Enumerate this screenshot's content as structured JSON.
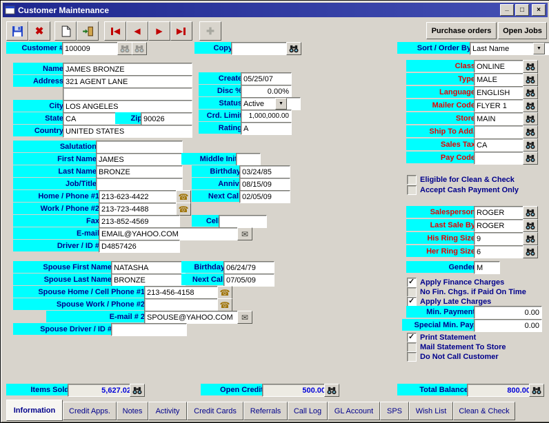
{
  "window": {
    "title": "Customer Maintenance"
  },
  "icons": {
    "minimize": "_",
    "maximize": "□",
    "close": "×",
    "delete": "✖",
    "plus": "✚",
    "prev": "◀",
    "next": "▶",
    "dropdown": "▼",
    "phone": "☎",
    "mail": "✉"
  },
  "toolbar": {
    "purchase_orders": "Purchase orders",
    "open_jobs": "Open Jobs"
  },
  "header": {
    "customer_label": "Customer #",
    "customer_value": "100009",
    "copy_label": "Copy",
    "copy_value": "",
    "sort_label": "Sort / Order By",
    "sort_value": "Last Name"
  },
  "left": {
    "name": {
      "label": "Name",
      "value": "JAMES BRONZE"
    },
    "address": {
      "label": "Address",
      "value": "321 AGENT LANE"
    },
    "address2": {
      "value": ""
    },
    "city": {
      "label": "City",
      "value": "LOS ANGELES"
    },
    "state": {
      "label": "State",
      "value": "CA"
    },
    "zip": {
      "label": "Zip",
      "value": "90026"
    },
    "country": {
      "label": "Country",
      "value": "UNITED STATES"
    },
    "salutation": {
      "label": "Salutation",
      "value": ""
    },
    "first_name": {
      "label": "First Name",
      "value": "JAMES"
    },
    "middle_init": {
      "label": "Middle Init",
      "value": ""
    },
    "last_name": {
      "label": "Last Name",
      "value": "BRONZE"
    },
    "job_title": {
      "label": "Job/Title",
      "value": ""
    },
    "home_phone": {
      "label": "Home / Phone #1",
      "value": "213-623-4422"
    },
    "work_phone": {
      "label": "Work / Phone #2",
      "value": "213-723-4488"
    },
    "fax": {
      "label": "Fax",
      "value": "213-852-4569"
    },
    "cell": {
      "label": "Cell",
      "value": ""
    },
    "email": {
      "label": "E-mail",
      "value": "EMAIL@YAHOO.COM"
    },
    "driver_id": {
      "label": "Driver / ID #",
      "value": "D4857426"
    },
    "spouse_first": {
      "label": "Spouse First Name",
      "value": "NATASHA"
    },
    "spouse_last": {
      "label": "Spouse Last Name",
      "value": "BRONZE"
    },
    "spouse_home": {
      "label": "Spouse Home / Cell Phone #1",
      "value": "213-456-4158"
    },
    "spouse_work": {
      "label": "Spouse Work / Phone #2",
      "value": ""
    },
    "email2": {
      "label": "E-mail # 2",
      "value": "SPOUSE@YAHOO.COM"
    },
    "spouse_driver": {
      "label": "Spouse Driver / ID #",
      "value": ""
    }
  },
  "mid": {
    "create": {
      "label": "Create",
      "value": "05/25/07"
    },
    "disc": {
      "label": "Disc %",
      "value": "0.00%"
    },
    "status": {
      "label": "Status",
      "value": "Active"
    },
    "crd_limit": {
      "label": "Crd. Limit",
      "value": "1,000,000.00"
    },
    "rating": {
      "label": "Rating",
      "value": "A"
    },
    "birthday": {
      "label": "Birthday",
      "value": "03/24/85"
    },
    "anniv": {
      "label": "Anniv.",
      "value": "08/15/09"
    },
    "next_call": {
      "label": "Next Call",
      "value": "02/05/09"
    },
    "spouse_birthday": {
      "label": "Birthday",
      "value": "06/24/79"
    },
    "spouse_next_call": {
      "label": "Next Call",
      "value": "07/05/09"
    }
  },
  "right": {
    "class": {
      "label": "Class",
      "value": "ONLINE"
    },
    "type": {
      "label": "Type",
      "value": "MALE"
    },
    "language": {
      "label": "Language",
      "value": "ENGLISH"
    },
    "mailer_code": {
      "label": "Mailer Code",
      "value": "FLYER 1"
    },
    "store": {
      "label": "Store",
      "value": "MAIN"
    },
    "ship_to": {
      "label": "Ship To Add.",
      "value": ""
    },
    "sales_tax": {
      "label": "Sales Tax",
      "value": "CA"
    },
    "pay_code": {
      "label": "Pay Code",
      "value": ""
    },
    "salesperson": {
      "label": "Salesperson",
      "value": "ROGER"
    },
    "last_sale_by": {
      "label": "Last Sale By",
      "value": "ROGER"
    },
    "his_ring": {
      "label": "His Ring Size",
      "value": "9"
    },
    "her_ring": {
      "label": "Her Ring Size",
      "value": "6"
    },
    "gender": {
      "label": "Gender",
      "value": "M"
    },
    "min_payment": {
      "label": "Min. Payment",
      "value": "0.00"
    },
    "special_min": {
      "label": "Special Min. Pay.",
      "value": "0.00"
    }
  },
  "checkboxes": {
    "clean_check": {
      "label": "Eligible for Clean & Check",
      "checked": false
    },
    "cash_only": {
      "label": "Accept Cash Payment Only",
      "checked": false
    },
    "finance": {
      "label": "Apply Finance Charges",
      "checked": true
    },
    "no_fin": {
      "label": "No Fin. Chgs. if Paid On Time",
      "checked": false
    },
    "late": {
      "label": "Apply Late Charges",
      "checked": true
    },
    "print_stmt": {
      "label": "Print Statement",
      "checked": true
    },
    "mail_stmt": {
      "label": "Mail Statement To Store",
      "checked": false
    },
    "no_call": {
      "label": "Do Not Call Customer",
      "checked": false
    }
  },
  "totals": {
    "items_sold": {
      "label": "Items Sold",
      "value": "5,627.02"
    },
    "open_credit": {
      "label": "Open Credit",
      "value": "500.00"
    },
    "total_balance": {
      "label": "Total Balance",
      "value": "800.00"
    }
  },
  "tabs": [
    "Information",
    "Credit Apps.",
    "Notes",
    "Activity",
    "Credit Cards",
    "Referrals",
    "Call Log",
    "GL Account",
    "SPS",
    "Wish List",
    "Clean & Check"
  ]
}
